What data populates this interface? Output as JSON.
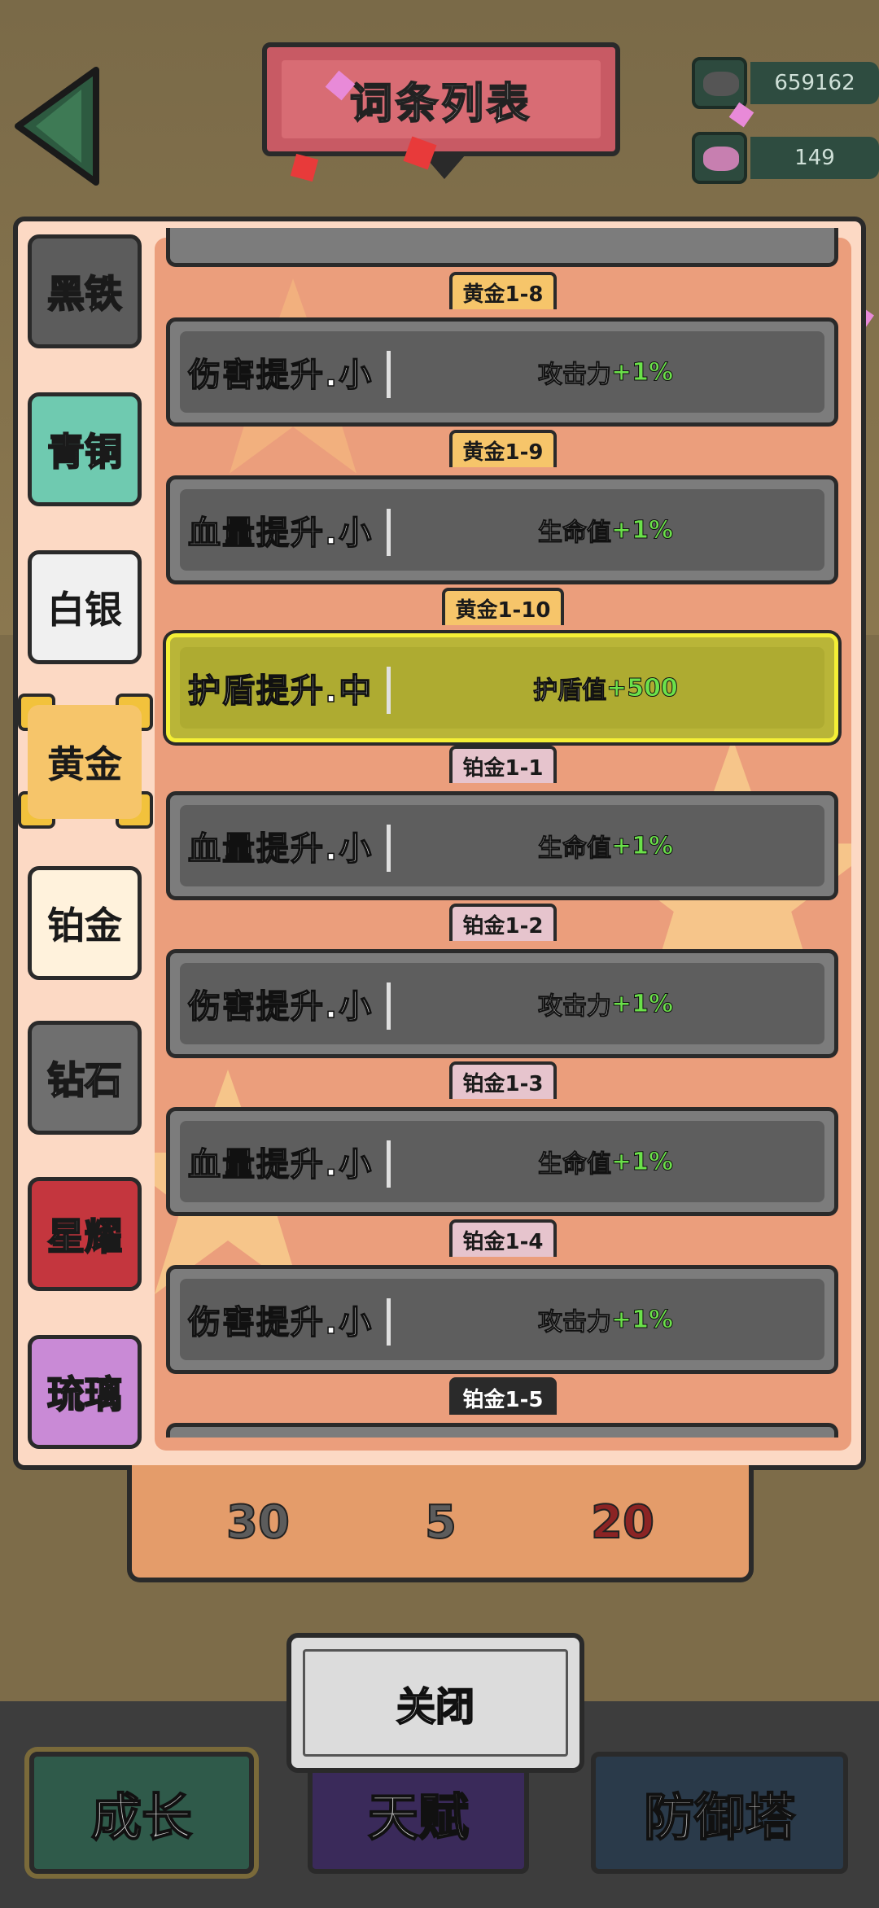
{
  "header": {
    "title": "词条列表"
  },
  "resources": [
    {
      "icon": "ore-icon",
      "value": "659162",
      "color": "#555555"
    },
    {
      "icon": "crystal-icon",
      "value": "149",
      "color": "#c77fb0"
    }
  ],
  "tabs": [
    {
      "label": "黑铁",
      "icon": "black-iron-icon",
      "color": "#5c5c5c",
      "selected": false
    },
    {
      "label": "青铜",
      "icon": "bronze-icon",
      "color": "#6fcab0",
      "selected": false
    },
    {
      "label": "白银",
      "icon": "silver-icon",
      "color": "#f0f0f0",
      "selected": false
    },
    {
      "label": "黄金",
      "icon": "gold-icon",
      "color": "#f6c56a",
      "selected": true
    },
    {
      "label": "铂金",
      "icon": "platinum-icon",
      "color": "#fff2dc",
      "selected": false
    },
    {
      "label": "钻石",
      "icon": "diamond-icon",
      "color": "#6f6f6f",
      "selected": false
    },
    {
      "label": "星耀",
      "icon": "star-icon",
      "color": "#c4363e",
      "selected": false
    },
    {
      "label": "琉璃",
      "icon": "glaze-icon",
      "color": "#c98ad6",
      "selected": false
    }
  ],
  "entries": [
    {
      "tag": "黄金1-8",
      "name": "伤害提升.小",
      "attr": "攻击力",
      "value": "+1%",
      "highlight": false
    },
    {
      "tag": "黄金1-9",
      "name": "血量提升.小",
      "attr": "生命值",
      "value": "+1%",
      "highlight": false
    },
    {
      "tag": "黄金1-10",
      "name": "护盾提升.中",
      "attr": "护盾值",
      "value": "+500",
      "highlight": true
    },
    {
      "tag": "铂金1-1",
      "name": "血量提升.小",
      "attr": "生命值",
      "value": "+1%",
      "highlight": false
    },
    {
      "tag": "铂金1-2",
      "name": "伤害提升.小",
      "attr": "攻击力",
      "value": "+1%",
      "highlight": false
    },
    {
      "tag": "铂金1-3",
      "name": "血量提升.小",
      "attr": "生命值",
      "value": "+1%",
      "highlight": false
    },
    {
      "tag": "铂金1-4",
      "name": "伤害提升.小",
      "attr": "攻击力",
      "value": "+1%",
      "highlight": false
    },
    {
      "tag": "铂金1-5"
    }
  ],
  "stats": [
    "30",
    "5",
    "20"
  ],
  "close_label": "关闭",
  "bottom_nav": [
    {
      "label": "成长",
      "color": "#2f5a4a"
    },
    {
      "label": "天赋",
      "color": "#3a2a5a"
    },
    {
      "label": "防御塔",
      "color": "#2a3a4a"
    }
  ]
}
